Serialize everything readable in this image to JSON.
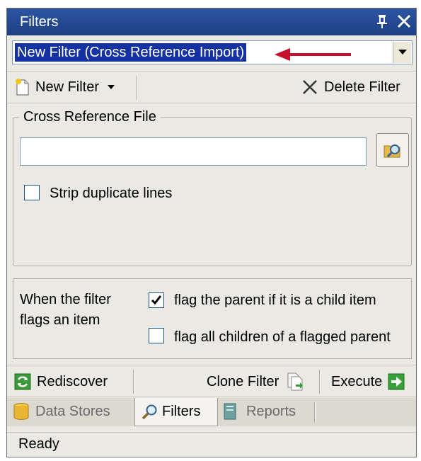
{
  "window": {
    "title": "Filters"
  },
  "filter_select": {
    "selected": "New Filter (Cross Reference Import)"
  },
  "toolbar": {
    "new_filter": "New Filter",
    "delete_filter": "Delete Filter"
  },
  "cross_reference": {
    "group_label": "Cross Reference File",
    "file_value": "",
    "strip_duplicates_label": "Strip duplicate lines",
    "strip_duplicates_checked": false
  },
  "flag_options": {
    "description": "When the filter flags an item",
    "flag_parent_label": "flag the parent if it is a child item",
    "flag_parent_checked": true,
    "flag_children_label": "flag all children of a flagged parent",
    "flag_children_checked": false
  },
  "actions": {
    "rediscover": "Rediscover",
    "clone_filter": "Clone Filter",
    "execute": "Execute"
  },
  "tabs": [
    {
      "label": "Data Stores",
      "active": false
    },
    {
      "label": "Filters",
      "active": true
    },
    {
      "label": "Reports",
      "active": false
    }
  ],
  "status": {
    "text": "Ready"
  },
  "colors": {
    "title_bar": "#2d55a1",
    "selection": "#1432a3",
    "annotation_arrow": "#c8102e"
  },
  "icons": [
    "pin-icon",
    "close-icon",
    "dropdown-icon",
    "new-document-icon",
    "delete-x-icon",
    "browse-folder-icon",
    "rediscover-icon",
    "clone-icon",
    "execute-icon",
    "database-icon",
    "magnifier-icon",
    "reports-icon"
  ]
}
